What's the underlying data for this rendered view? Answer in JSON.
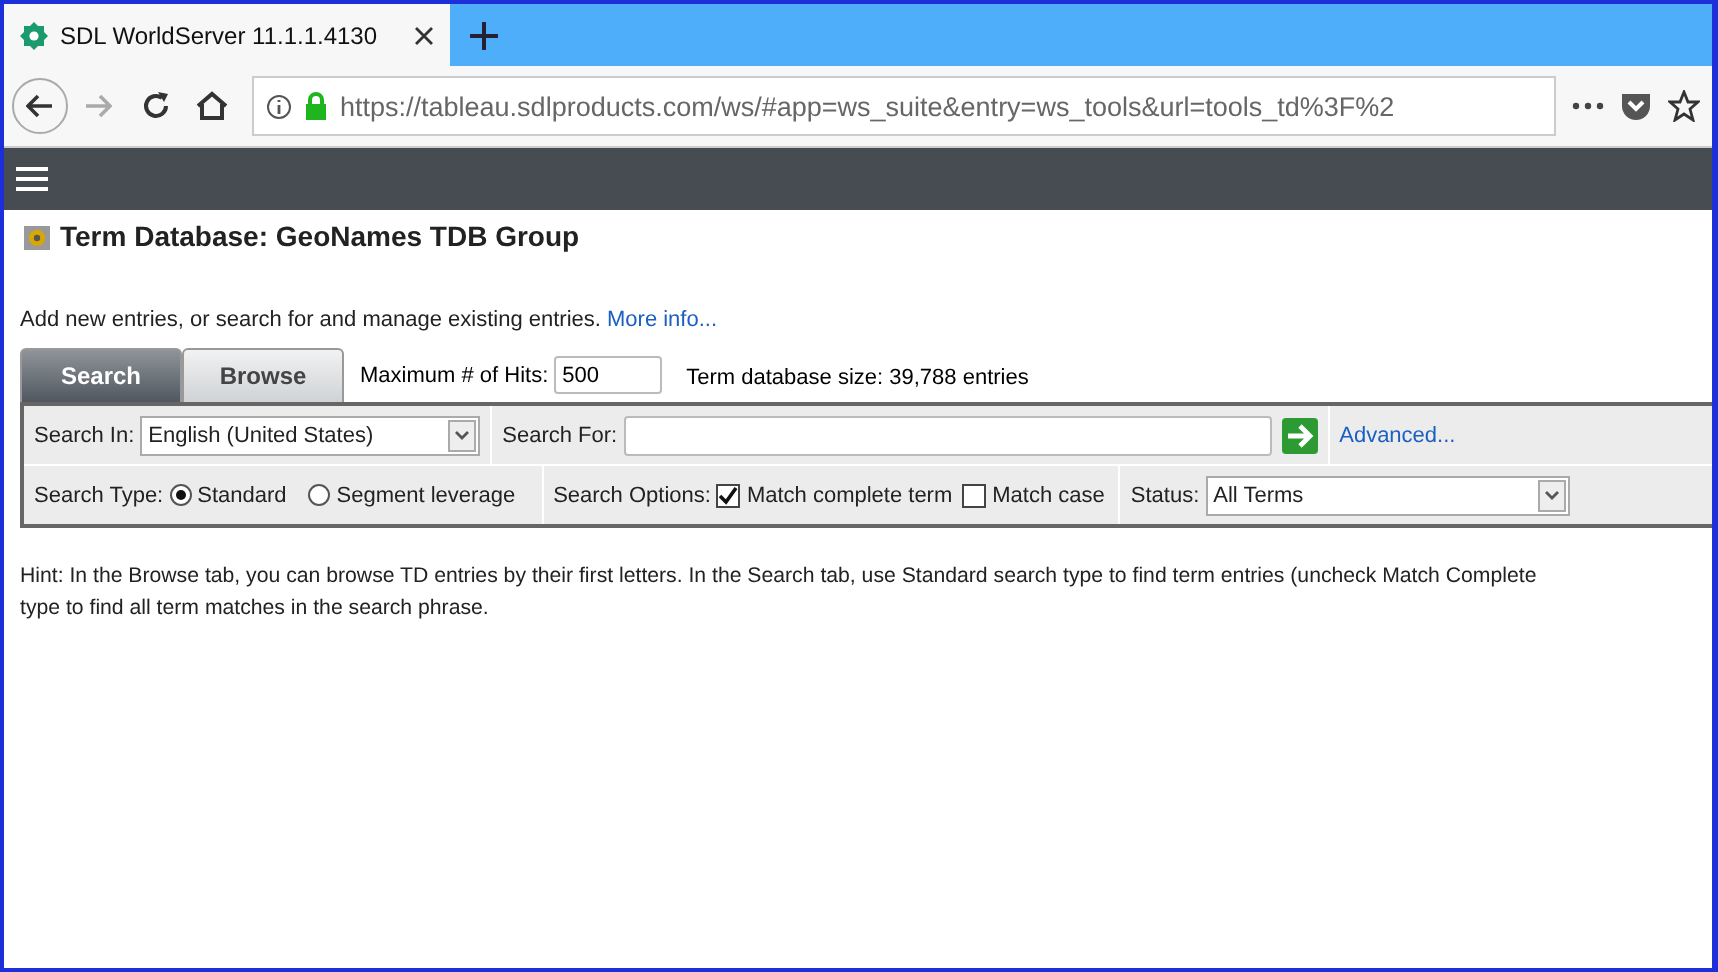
{
  "browser": {
    "tab_title": "SDL WorldServer 11.1.1.4130",
    "url": "https://tableau.sdlproducts.com/ws/#app=ws_suite&entry=ws_tools&url=tools_td%3F%2"
  },
  "page": {
    "title": "Term Database: GeoNames TDB Group",
    "description": "Add new entries, or search for and manage existing entries.",
    "more_link": "More info..."
  },
  "tabs": [
    {
      "label": "Search",
      "selected": true
    },
    {
      "label": "Browse",
      "selected": false
    }
  ],
  "max_hits": {
    "label": "Maximum # of Hits:",
    "value": "500"
  },
  "db_size": "Term database size: 39,788 entries",
  "search_in": {
    "label": "Search In:",
    "value": "English (United States)"
  },
  "search_for": {
    "label": "Search For:"
  },
  "advanced_link": "Advanced...",
  "search_type": {
    "label": "Search Type:",
    "options": [
      {
        "label": "Standard",
        "selected": true
      },
      {
        "label": "Segment leverage",
        "selected": false
      }
    ]
  },
  "search_options": {
    "label": "Search Options:",
    "options": [
      {
        "label": "Match complete term",
        "checked": true
      },
      {
        "label": "Match case",
        "checked": false
      }
    ]
  },
  "status": {
    "label": "Status:",
    "value": "All Terms"
  },
  "hint_lines": [
    "Hint: In the Browse tab, you can browse TD entries by their first letters. In the Search tab, use Standard search type to find term entries (uncheck Match Complete",
    "type to find all term matches in the search phrase."
  ]
}
